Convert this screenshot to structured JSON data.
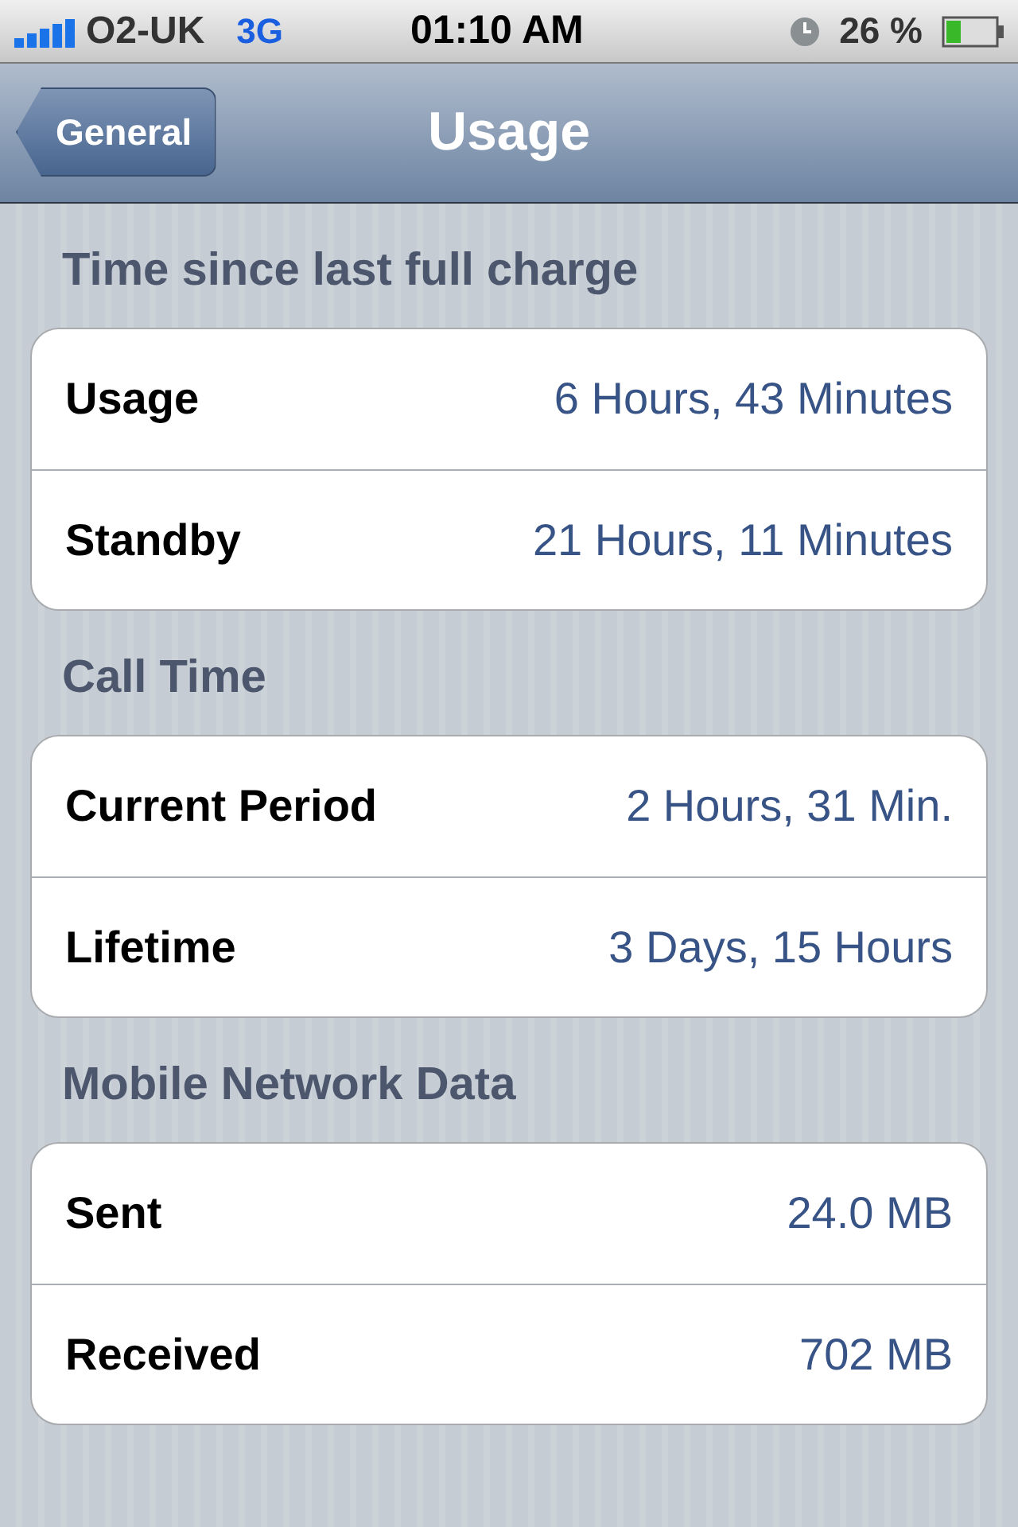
{
  "status_bar": {
    "carrier": "O2-UK",
    "network": "3G",
    "time": "01:10 AM",
    "battery": "26 %"
  },
  "nav_bar": {
    "back": "General",
    "title": "Usage"
  },
  "sections": [
    {
      "header": "Time since last full charge",
      "rows": [
        {
          "label": "Usage",
          "value": "6 Hours, 43 Minutes"
        },
        {
          "label": "Standby",
          "value": "21 Hours, 11 Minutes"
        }
      ]
    },
    {
      "header": "Call Time",
      "rows": [
        {
          "label": "Current Period",
          "value": "2 Hours, 31 Min."
        },
        {
          "label": "Lifetime",
          "value": "3 Days, 15 Hours"
        }
      ]
    },
    {
      "header": "Mobile Network Data",
      "rows": [
        {
          "label": "Sent",
          "value": "24.0 MB"
        },
        {
          "label": "Received",
          "value": "702 MB"
        }
      ]
    }
  ]
}
